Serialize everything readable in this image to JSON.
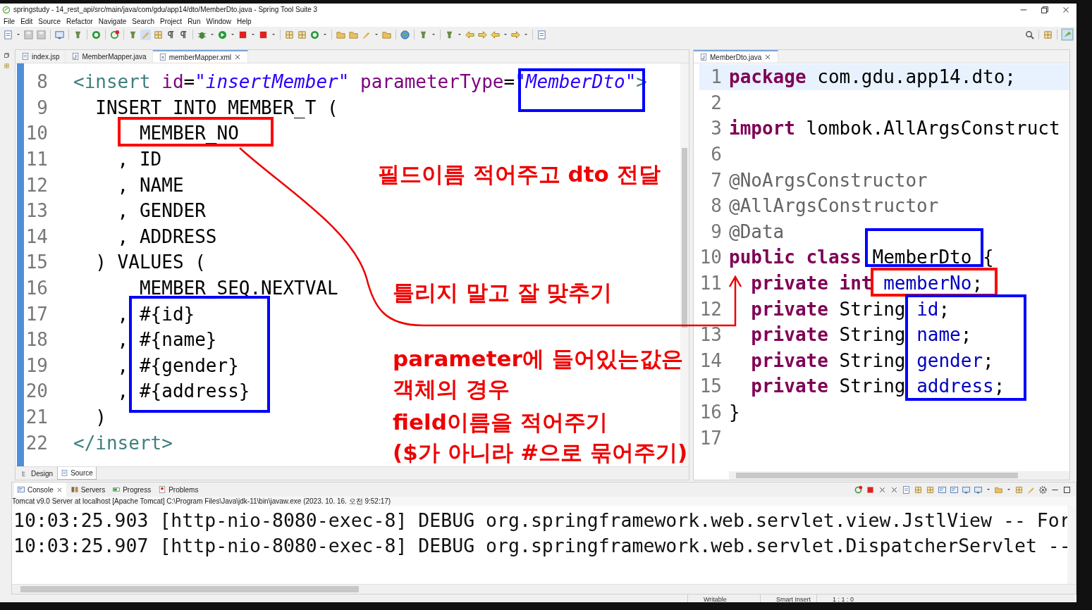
{
  "window": {
    "title": "springstudy - 14_rest_api/src/main/java/com/gdu/app14/dto/MemberDto.java - Spring Tool Suite 3"
  },
  "menu": [
    "File",
    "Edit",
    "Source",
    "Refactor",
    "Navigate",
    "Search",
    "Project",
    "Run",
    "Window",
    "Help"
  ],
  "left_editor": {
    "tabs": [
      {
        "label": "index.jsp",
        "selected": false
      },
      {
        "label": "MemberMapper.java",
        "selected": false
      },
      {
        "label": "memberMapper.xml",
        "selected": true
      }
    ],
    "lines": [
      {
        "number": "8",
        "tokens": [
          {
            "text": "<insert ",
            "kind": "tag"
          },
          {
            "text": "id",
            "kind": "attr"
          },
          {
            "text": "=",
            "kind": "plain"
          },
          {
            "text": "\"insertMember\"",
            "kind": "value"
          },
          {
            "text": " parameterType",
            "kind": "attr"
          },
          {
            "text": "=",
            "kind": "plain"
          },
          {
            "text": "\"MemberDto\"",
            "kind": "value"
          },
          {
            "text": ">",
            "kind": "tag"
          }
        ]
      },
      {
        "number": "9",
        "tokens": [
          {
            "text": "  INSERT INTO MEMBER_T (",
            "kind": "plain"
          }
        ]
      },
      {
        "number": "10",
        "tokens": [
          {
            "text": "      MEMBER_NO",
            "kind": "plain"
          }
        ]
      },
      {
        "number": "11",
        "tokens": [
          {
            "text": "    , ID",
            "kind": "plain"
          }
        ]
      },
      {
        "number": "12",
        "tokens": [
          {
            "text": "    , NAME",
            "kind": "plain"
          }
        ]
      },
      {
        "number": "13",
        "tokens": [
          {
            "text": "    , GENDER",
            "kind": "plain"
          }
        ]
      },
      {
        "number": "14",
        "tokens": [
          {
            "text": "    , ADDRESS",
            "kind": "plain"
          }
        ]
      },
      {
        "number": "15",
        "tokens": [
          {
            "text": "  ) VALUES (",
            "kind": "plain"
          }
        ]
      },
      {
        "number": "16",
        "tokens": [
          {
            "text": "      MEMBER_SEQ.NEXTVAL",
            "kind": "plain"
          }
        ]
      },
      {
        "number": "17",
        "tokens": [
          {
            "text": "    , #{id}",
            "kind": "plain"
          }
        ]
      },
      {
        "number": "18",
        "tokens": [
          {
            "text": "    , #{name}",
            "kind": "plain"
          }
        ]
      },
      {
        "number": "19",
        "tokens": [
          {
            "text": "    , #{gender}",
            "kind": "plain"
          }
        ]
      },
      {
        "number": "20",
        "tokens": [
          {
            "text": "    , #{address}",
            "kind": "plain"
          }
        ]
      },
      {
        "number": "21",
        "tokens": [
          {
            "text": "  )",
            "kind": "plain"
          }
        ]
      },
      {
        "number": "22",
        "tokens": [
          {
            "text": "</insert>",
            "kind": "tag"
          }
        ]
      }
    ],
    "bottom_tabs": [
      {
        "label": "Design",
        "selected": false
      },
      {
        "label": "Source",
        "selected": true
      }
    ]
  },
  "right_editor": {
    "tabs": [
      {
        "label": "MemberDto.java",
        "selected": true
      }
    ],
    "lines": [
      {
        "number": "1",
        "tokens": [
          {
            "text": "package",
            "kind": "keyword"
          },
          {
            "text": " com.gdu.app14.dto;",
            "kind": "plain"
          }
        ]
      },
      {
        "number": "2"
      },
      {
        "number": "3",
        "tokens": [
          {
            "text": "import",
            "kind": "keyword"
          },
          {
            "text": " lombok.AllArgsConstruct",
            "kind": "plain"
          }
        ]
      },
      {
        "number": "6"
      },
      {
        "number": "7",
        "tokens": [
          {
            "text": "@NoArgsConstructor",
            "kind": "annotation"
          }
        ]
      },
      {
        "number": "8",
        "tokens": [
          {
            "text": "@AllArgsConstructor",
            "kind": "annotation"
          }
        ]
      },
      {
        "number": "9",
        "tokens": [
          {
            "text": "@Data",
            "kind": "annotation"
          }
        ]
      },
      {
        "number": "10",
        "tokens": [
          {
            "text": "public class",
            "kind": "keyword"
          },
          {
            "text": " MemberDto {",
            "kind": "plain"
          }
        ]
      },
      {
        "number": "11",
        "tokens": [
          {
            "text": "  private int",
            "kind": "keyword"
          },
          {
            "text": " memberNo",
            "kind": "field"
          },
          {
            "text": ";",
            "kind": "plain"
          }
        ]
      },
      {
        "number": "12",
        "tokens": [
          {
            "text": "  private",
            "kind": "keyword"
          },
          {
            "text": " String ",
            "kind": "plain"
          },
          {
            "text": "id",
            "kind": "field"
          },
          {
            "text": ";",
            "kind": "plain"
          }
        ]
      },
      {
        "number": "13",
        "tokens": [
          {
            "text": "  private",
            "kind": "keyword"
          },
          {
            "text": " String ",
            "kind": "plain"
          },
          {
            "text": "name",
            "kind": "field"
          },
          {
            "text": ";",
            "kind": "plain"
          }
        ]
      },
      {
        "number": "14",
        "tokens": [
          {
            "text": "  private",
            "kind": "keyword"
          },
          {
            "text": " String ",
            "kind": "plain"
          },
          {
            "text": "gender",
            "kind": "field"
          },
          {
            "text": ";",
            "kind": "plain"
          }
        ]
      },
      {
        "number": "15",
        "tokens": [
          {
            "text": "  private",
            "kind": "keyword"
          },
          {
            "text": " String ",
            "kind": "plain"
          },
          {
            "text": "address",
            "kind": "field"
          },
          {
            "text": ";",
            "kind": "plain"
          }
        ]
      },
      {
        "number": "16",
        "tokens": [
          {
            "text": "}",
            "kind": "plain"
          }
        ]
      },
      {
        "number": "17"
      }
    ]
  },
  "highlight_boxes": [
    {
      "color": "#0000ff"
    },
    {
      "color": "#ff0000"
    },
    {
      "color": "#0000ff"
    },
    {
      "color": "#0000ff"
    },
    {
      "color": "#ff0000"
    },
    {
      "color": "#0000ff"
    }
  ],
  "annotations": [
    {
      "text": "필드이름 적어주고 dto 전달"
    },
    {
      "text": "틀리지 말고 잘 맞추기"
    },
    {
      "text": "parameter에 들어있는값은"
    },
    {
      "text": "객체의 경우"
    },
    {
      "text": "field이름을 적어주기"
    },
    {
      "text": "($가 아니라 #으로 묶어주기)"
    }
  ],
  "console": {
    "tabs": [
      {
        "label": "Console",
        "selected": true
      },
      {
        "label": "Servers",
        "selected": false
      },
      {
        "label": "Progress",
        "selected": false
      },
      {
        "label": "Problems",
        "selected": false
      }
    ],
    "process": "Tomcat v9.0 Server at localhost [Apache Tomcat] C:\\Program Files\\Java\\jdk-11\\bin\\javaw.exe  (2023. 10. 16. 오전 9:52:17)",
    "lines": [
      "10:03:25.903 [http-nio-8080-exec-8] DEBUG org.springframework.web.servlet.view.JstlView -- For",
      "10:03:25.907 [http-nio-8080-exec-8] DEBUG org.springframework.web.servlet.DispatcherServlet --"
    ]
  },
  "status_bar": [
    "Writable",
    "Smart Insert",
    "1 : 1 : 0"
  ]
}
